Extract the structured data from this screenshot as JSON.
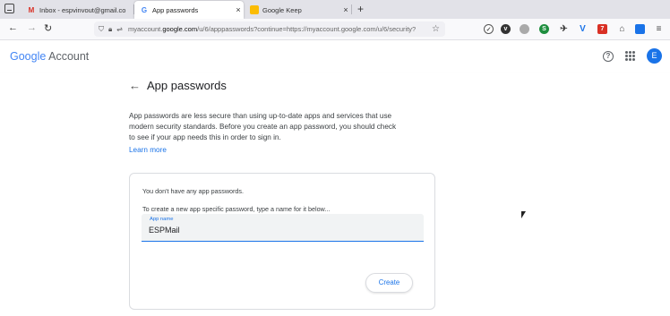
{
  "browser": {
    "tabs": [
      {
        "label": "Inbox - espvinvout@gmail.co",
        "icon": "gmail-icon",
        "active": false
      },
      {
        "label": "App passwords",
        "icon": "google-g-icon",
        "active": true
      },
      {
        "label": "Google Keep",
        "icon": "keep-icon",
        "active": false
      }
    ],
    "close_glyph": "×",
    "new_tab_glyph": "+",
    "url_prefix": "myaccount.",
    "url_domain": "google.com",
    "url_rest": "/u/6/apppasswords?continue=https://myaccount.google.com/u/6/security?",
    "colors": {
      "tabbar_bg": "#e2e2e8",
      "urlbar_bg": "#f0f0f4"
    }
  },
  "header": {
    "logo_google": "Google",
    "logo_account": "Account",
    "avatar_letter": "E",
    "help_glyph": "?"
  },
  "titlebar": {
    "back_glyph": "←",
    "title": "App passwords"
  },
  "main": {
    "intro": "App passwords are less secure than using up-to-date apps and services that use modern security standards. Before you create an app password, you should check to see if your app needs this in order to sign in.",
    "learn_more": "Learn more",
    "no_passwords": "You don't have any app passwords.",
    "create_hint": "To create a new app specific password, type a name for it below...",
    "field_label": "App name",
    "field_value": "ESPMail",
    "create_button": "Create"
  },
  "accent_color": "#1a73e8"
}
